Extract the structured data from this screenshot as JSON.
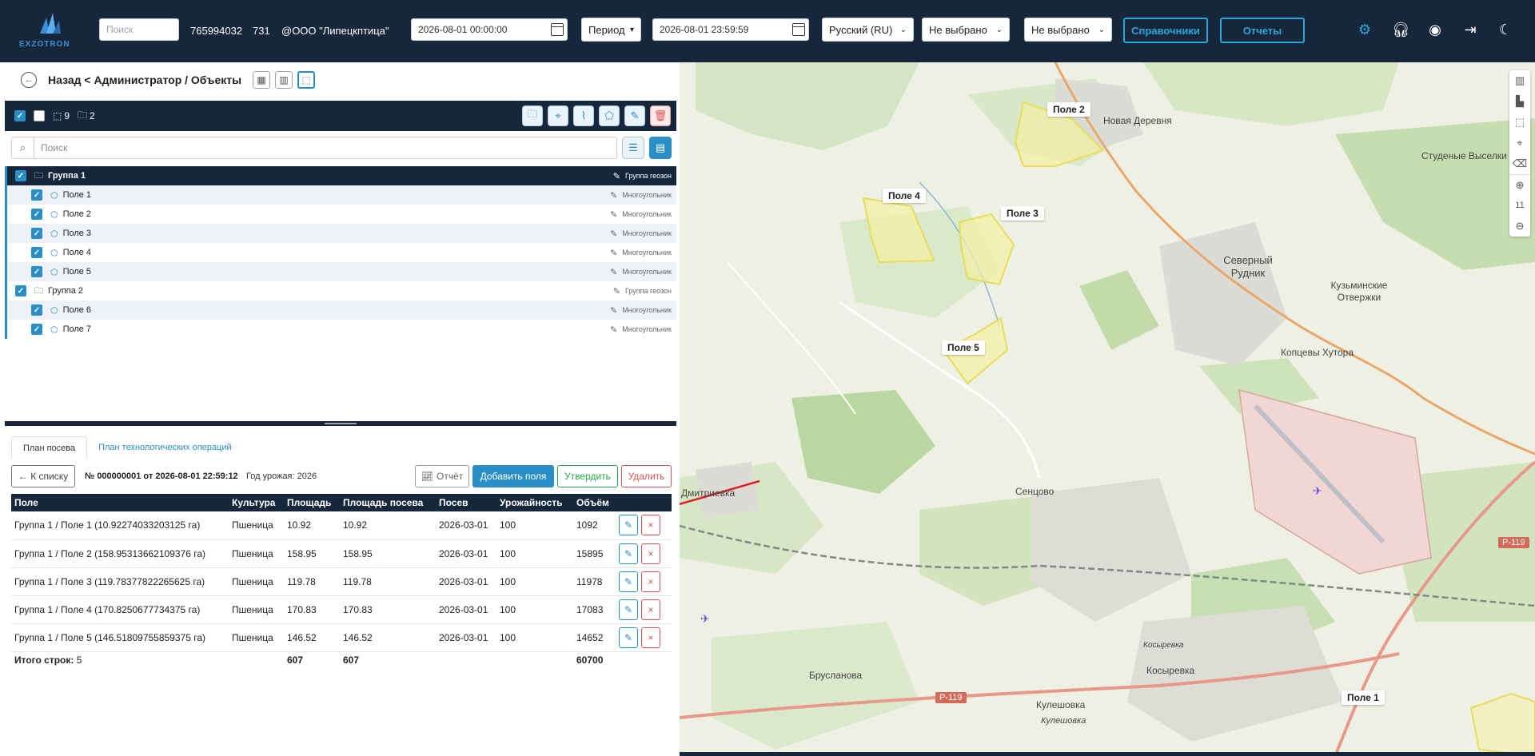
{
  "topbar": {
    "logo_text": "EXZOTRON",
    "search_placeholder": "Поиск",
    "account_id": "765994032",
    "count": "731",
    "org_name": "@ООО \"Липецкптица\"",
    "date_from": "2026-08-01 00:00:00",
    "period_label": "Период",
    "date_to": "2026-08-01 23:59:59",
    "language": "Русский (RU)",
    "filter1": "Не выбрано",
    "filter2": "Не выбрано",
    "directories_label": "Справочники",
    "reports_label": "Отчеты"
  },
  "breadcrumb": "Назад < Администратор / Объекты",
  "toolbar": {
    "geozone_count": "9",
    "group_count": "2"
  },
  "search": {
    "placeholder": "Поиск"
  },
  "tree": [
    {
      "label": "Группа 1",
      "type": "Группа геозон",
      "kind": "group",
      "style": "group-dark"
    },
    {
      "label": "Поле 1",
      "type": "Многоугольник",
      "kind": "item",
      "style": "alt"
    },
    {
      "label": "Поле 2",
      "type": "Многоугольник",
      "kind": "item",
      "style": "plain"
    },
    {
      "label": "Поле 3",
      "type": "Многоугольник",
      "kind": "item",
      "style": "alt"
    },
    {
      "label": "Поле 4",
      "type": "Многоугольник",
      "kind": "item",
      "style": "plain"
    },
    {
      "label": "Поле 5",
      "type": "Многоугольник",
      "kind": "item",
      "style": "alt"
    },
    {
      "label": "Группа 2",
      "type": "Группа геозон",
      "kind": "group",
      "style": "plain"
    },
    {
      "label": "Поле 6",
      "type": "Многоугольник",
      "kind": "item",
      "style": "alt"
    },
    {
      "label": "Поле 7",
      "type": "Многоугольник",
      "kind": "item",
      "style": "plain"
    }
  ],
  "tabs": [
    "План посева",
    "План технологических операций"
  ],
  "doc": {
    "back_label": "← К списку",
    "title": "№ 000000001 от 2026-08-01 22:59:12",
    "year": "Год урожая: 2026",
    "report_label": "Отчёт",
    "add_fields_label": "Добавить поля",
    "approve_label": "Утвердить",
    "delete_label": "Удалить"
  },
  "table": {
    "headers": [
      "Поле",
      "Культура",
      "Площадь",
      "Площадь посева",
      "Посев",
      "Урожайность",
      "Объём"
    ],
    "rows": [
      [
        "Группа 1 / Поле 1 (10.92274033203125 га)",
        "Пшеница",
        "10.92",
        "10.92",
        "2026-03-01",
        "100",
        "1092"
      ],
      [
        "Группа 1 / Поле 2 (158.95313662109376 га)",
        "Пшеница",
        "158.95",
        "158.95",
        "2026-03-01",
        "100",
        "15895"
      ],
      [
        "Группа 1 / Поле 3 (119.78377822265625 га)",
        "Пшеница",
        "119.78",
        "119.78",
        "2026-03-01",
        "100",
        "11978"
      ],
      [
        "Группа 1 / Поле 4 (170.8250677734375 га)",
        "Пшеница",
        "170.83",
        "170.83",
        "2026-03-01",
        "100",
        "17083"
      ],
      [
        "Группа 1 / Поле 5 (146.51809755859375 га)",
        "Пшеница",
        "146.52",
        "146.52",
        "2026-03-01",
        "100",
        "14652"
      ]
    ],
    "total_label": "Итого строк:",
    "total_count": "5",
    "total_area": "607",
    "total_sown": "607",
    "total_volume": "60700"
  },
  "map": {
    "zoom": "11",
    "fields": [
      "Поле 2",
      "Поле 4",
      "Поле 3",
      "Поле 5",
      "Поле 1"
    ],
    "places": [
      "Новая Деревня",
      "Студеные Выселки",
      "Северный Рудник",
      "Кузьминские Отвержки",
      "Копцевы Хутора",
      "Сенцово",
      "Дмитриевка",
      "Брусланова",
      "Косыревка",
      "Косыревка",
      "Кулешовка",
      "Кулешовка"
    ],
    "roads": [
      "Р-119",
      "Р-119"
    ]
  },
  "colors": {
    "header_bg": "#16273b",
    "accent": "#2a8ec7",
    "cyan": "#2aa7d9",
    "success": "#28a745",
    "danger": "#d9534f"
  }
}
